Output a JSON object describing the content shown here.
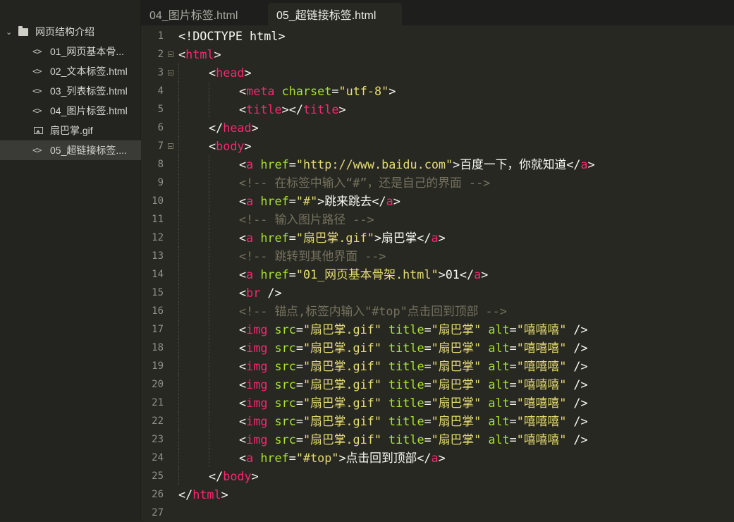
{
  "tabs": [
    {
      "label": "04_图片标签.html",
      "active": false
    },
    {
      "label": "05_超链接标签.html",
      "active": true
    }
  ],
  "sidebar": {
    "folder": "网页结构介绍",
    "files": [
      {
        "label": "01_网页基本骨...",
        "icon": "code-file-icon",
        "active": false
      },
      {
        "label": "02_文本标签.html",
        "icon": "code-file-icon",
        "active": false
      },
      {
        "label": "03_列表标签.html",
        "icon": "code-file-icon",
        "active": false
      },
      {
        "label": "04_图片标签.html",
        "icon": "code-file-icon",
        "active": false
      },
      {
        "label": "扇巴掌.gif",
        "icon": "image-file-icon",
        "active": false
      },
      {
        "label": "05_超链接标签....",
        "icon": "code-file-icon",
        "active": true
      }
    ]
  },
  "editor": {
    "colors": {
      "background": "#272822",
      "tag": "#f92672",
      "attribute": "#a6e22e",
      "string": "#e6db74",
      "comment": "#75715e",
      "text": "#f8f8f2"
    },
    "lines": [
      {
        "n": "1",
        "fold": false,
        "indent": 0,
        "tokens": [
          [
            "p",
            "<!DOCTYPE html>"
          ]
        ]
      },
      {
        "n": "2",
        "fold": true,
        "indent": 0,
        "tokens": [
          [
            "p",
            "<"
          ],
          [
            "t",
            "html"
          ],
          [
            "p",
            ">"
          ]
        ]
      },
      {
        "n": "3",
        "fold": true,
        "indent": 1,
        "tokens": [
          [
            "p",
            "<"
          ],
          [
            "t",
            "head"
          ],
          [
            "p",
            ">"
          ]
        ]
      },
      {
        "n": "4",
        "fold": false,
        "indent": 2,
        "tokens": [
          [
            "p",
            "<"
          ],
          [
            "t",
            "meta"
          ],
          [
            "p",
            " "
          ],
          [
            "a",
            "charset"
          ],
          [
            "p",
            "="
          ],
          [
            "s",
            "\"utf-8\""
          ],
          [
            "p",
            ">"
          ]
        ]
      },
      {
        "n": "5",
        "fold": false,
        "indent": 2,
        "tokens": [
          [
            "p",
            "<"
          ],
          [
            "t",
            "title"
          ],
          [
            "p",
            "></"
          ],
          [
            "t",
            "title"
          ],
          [
            "p",
            ">"
          ]
        ]
      },
      {
        "n": "6",
        "fold": false,
        "indent": 1,
        "tokens": [
          [
            "p",
            "</"
          ],
          [
            "t",
            "head"
          ],
          [
            "p",
            ">"
          ]
        ]
      },
      {
        "n": "7",
        "fold": true,
        "indent": 1,
        "tokens": [
          [
            "p",
            "<"
          ],
          [
            "t",
            "body"
          ],
          [
            "p",
            ">"
          ]
        ]
      },
      {
        "n": "8",
        "fold": false,
        "indent": 2,
        "tokens": [
          [
            "p",
            "<"
          ],
          [
            "t",
            "a"
          ],
          [
            "p",
            " "
          ],
          [
            "a",
            "href"
          ],
          [
            "p",
            "="
          ],
          [
            "s",
            "\"http://www.baidu.com\""
          ],
          [
            "p",
            ">"
          ],
          [
            "tx",
            "百度一下，你就知道"
          ],
          [
            "p",
            "</"
          ],
          [
            "t",
            "a"
          ],
          [
            "p",
            ">"
          ]
        ]
      },
      {
        "n": "9",
        "fold": false,
        "indent": 2,
        "tokens": [
          [
            "c",
            "<!-- 在标签中输入“#”，还是自己的界面 -->"
          ]
        ]
      },
      {
        "n": "10",
        "fold": false,
        "indent": 2,
        "tokens": [
          [
            "p",
            "<"
          ],
          [
            "t",
            "a"
          ],
          [
            "p",
            " "
          ],
          [
            "a",
            "href"
          ],
          [
            "p",
            "="
          ],
          [
            "s",
            "\"#\""
          ],
          [
            "p",
            ">"
          ],
          [
            "tx",
            "跳来跳去"
          ],
          [
            "p",
            "</"
          ],
          [
            "t",
            "a"
          ],
          [
            "p",
            ">"
          ]
        ]
      },
      {
        "n": "11",
        "fold": false,
        "indent": 2,
        "tokens": [
          [
            "c",
            "<!-- 输入图片路径 -->"
          ]
        ]
      },
      {
        "n": "12",
        "fold": false,
        "indent": 2,
        "tokens": [
          [
            "p",
            "<"
          ],
          [
            "t",
            "a"
          ],
          [
            "p",
            " "
          ],
          [
            "a",
            "href"
          ],
          [
            "p",
            "="
          ],
          [
            "s",
            "\"扇巴掌.gif\""
          ],
          [
            "p",
            ">"
          ],
          [
            "tx",
            "扇巴掌"
          ],
          [
            "p",
            "</"
          ],
          [
            "t",
            "a"
          ],
          [
            "p",
            ">"
          ]
        ]
      },
      {
        "n": "13",
        "fold": false,
        "indent": 2,
        "tokens": [
          [
            "c",
            "<!-- 跳转到其他界面 -->"
          ]
        ]
      },
      {
        "n": "14",
        "fold": false,
        "indent": 2,
        "tokens": [
          [
            "p",
            "<"
          ],
          [
            "t",
            "a"
          ],
          [
            "p",
            " "
          ],
          [
            "a",
            "href"
          ],
          [
            "p",
            "="
          ],
          [
            "s",
            "\"01_网页基本骨架.html\""
          ],
          [
            "p",
            ">"
          ],
          [
            "tx",
            "01"
          ],
          [
            "p",
            "</"
          ],
          [
            "t",
            "a"
          ],
          [
            "p",
            ">"
          ]
        ]
      },
      {
        "n": "15",
        "fold": false,
        "indent": 2,
        "tokens": [
          [
            "p",
            "<"
          ],
          [
            "t",
            "br"
          ],
          [
            "p",
            " />"
          ]
        ]
      },
      {
        "n": "16",
        "fold": false,
        "indent": 2,
        "tokens": [
          [
            "c",
            "<!-- 锚点,标签内输入\"#top\"点击回到顶部 -->"
          ]
        ]
      },
      {
        "n": "17",
        "fold": false,
        "indent": 2,
        "tokens": [
          [
            "p",
            "<"
          ],
          [
            "t",
            "img"
          ],
          [
            "p",
            " "
          ],
          [
            "a",
            "src"
          ],
          [
            "p",
            "="
          ],
          [
            "s",
            "\"扇巴掌.gif\""
          ],
          [
            "p",
            " "
          ],
          [
            "a",
            "title"
          ],
          [
            "p",
            "="
          ],
          [
            "s",
            "\"扇巴掌\""
          ],
          [
            "p",
            " "
          ],
          [
            "a",
            "alt"
          ],
          [
            "p",
            "="
          ],
          [
            "s",
            "\"嘻嘻嘻\""
          ],
          [
            "p",
            " />"
          ]
        ]
      },
      {
        "n": "18",
        "fold": false,
        "indent": 2,
        "tokens": [
          [
            "p",
            "<"
          ],
          [
            "t",
            "img"
          ],
          [
            "p",
            " "
          ],
          [
            "a",
            "src"
          ],
          [
            "p",
            "="
          ],
          [
            "s",
            "\"扇巴掌.gif\""
          ],
          [
            "p",
            " "
          ],
          [
            "a",
            "title"
          ],
          [
            "p",
            "="
          ],
          [
            "s",
            "\"扇巴掌\""
          ],
          [
            "p",
            " "
          ],
          [
            "a",
            "alt"
          ],
          [
            "p",
            "="
          ],
          [
            "s",
            "\"嘻嘻嘻\""
          ],
          [
            "p",
            " />"
          ]
        ]
      },
      {
        "n": "19",
        "fold": false,
        "indent": 2,
        "tokens": [
          [
            "p",
            "<"
          ],
          [
            "t",
            "img"
          ],
          [
            "p",
            " "
          ],
          [
            "a",
            "src"
          ],
          [
            "p",
            "="
          ],
          [
            "s",
            "\"扇巴掌.gif\""
          ],
          [
            "p",
            " "
          ],
          [
            "a",
            "title"
          ],
          [
            "p",
            "="
          ],
          [
            "s",
            "\"扇巴掌\""
          ],
          [
            "p",
            " "
          ],
          [
            "a",
            "alt"
          ],
          [
            "p",
            "="
          ],
          [
            "s",
            "\"嘻嘻嘻\""
          ],
          [
            "p",
            " />"
          ]
        ]
      },
      {
        "n": "20",
        "fold": false,
        "indent": 2,
        "tokens": [
          [
            "p",
            "<"
          ],
          [
            "t",
            "img"
          ],
          [
            "p",
            " "
          ],
          [
            "a",
            "src"
          ],
          [
            "p",
            "="
          ],
          [
            "s",
            "\"扇巴掌.gif\""
          ],
          [
            "p",
            " "
          ],
          [
            "a",
            "title"
          ],
          [
            "p",
            "="
          ],
          [
            "s",
            "\"扇巴掌\""
          ],
          [
            "p",
            " "
          ],
          [
            "a",
            "alt"
          ],
          [
            "p",
            "="
          ],
          [
            "s",
            "\"嘻嘻嘻\""
          ],
          [
            "p",
            " />"
          ]
        ]
      },
      {
        "n": "21",
        "fold": false,
        "indent": 2,
        "tokens": [
          [
            "p",
            "<"
          ],
          [
            "t",
            "img"
          ],
          [
            "p",
            " "
          ],
          [
            "a",
            "src"
          ],
          [
            "p",
            "="
          ],
          [
            "s",
            "\"扇巴掌.gif\""
          ],
          [
            "p",
            " "
          ],
          [
            "a",
            "title"
          ],
          [
            "p",
            "="
          ],
          [
            "s",
            "\"扇巴掌\""
          ],
          [
            "p",
            " "
          ],
          [
            "a",
            "alt"
          ],
          [
            "p",
            "="
          ],
          [
            "s",
            "\"嘻嘻嘻\""
          ],
          [
            "p",
            " />"
          ]
        ]
      },
      {
        "n": "22",
        "fold": false,
        "indent": 2,
        "tokens": [
          [
            "p",
            "<"
          ],
          [
            "t",
            "img"
          ],
          [
            "p",
            " "
          ],
          [
            "a",
            "src"
          ],
          [
            "p",
            "="
          ],
          [
            "s",
            "\"扇巴掌.gif\""
          ],
          [
            "p",
            " "
          ],
          [
            "a",
            "title"
          ],
          [
            "p",
            "="
          ],
          [
            "s",
            "\"扇巴掌\""
          ],
          [
            "p",
            " "
          ],
          [
            "a",
            "alt"
          ],
          [
            "p",
            "="
          ],
          [
            "s",
            "\"嘻嘻嘻\""
          ],
          [
            "p",
            " />"
          ]
        ]
      },
      {
        "n": "23",
        "fold": false,
        "indent": 2,
        "tokens": [
          [
            "p",
            "<"
          ],
          [
            "t",
            "img"
          ],
          [
            "p",
            " "
          ],
          [
            "a",
            "src"
          ],
          [
            "p",
            "="
          ],
          [
            "s",
            "\"扇巴掌.gif\""
          ],
          [
            "p",
            " "
          ],
          [
            "a",
            "title"
          ],
          [
            "p",
            "="
          ],
          [
            "s",
            "\"扇巴掌\""
          ],
          [
            "p",
            " "
          ],
          [
            "a",
            "alt"
          ],
          [
            "p",
            "="
          ],
          [
            "s",
            "\"嘻嘻嘻\""
          ],
          [
            "p",
            " />"
          ]
        ]
      },
      {
        "n": "24",
        "fold": false,
        "indent": 2,
        "tokens": [
          [
            "p",
            "<"
          ],
          [
            "t",
            "a"
          ],
          [
            "p",
            " "
          ],
          [
            "a",
            "href"
          ],
          [
            "p",
            "="
          ],
          [
            "s",
            "\"#top\""
          ],
          [
            "p",
            ">"
          ],
          [
            "tx",
            "点击回到顶部"
          ],
          [
            "p",
            "</"
          ],
          [
            "t",
            "a"
          ],
          [
            "p",
            ">"
          ]
        ]
      },
      {
        "n": "25",
        "fold": false,
        "indent": 1,
        "tokens": [
          [
            "p",
            "</"
          ],
          [
            "t",
            "body"
          ],
          [
            "p",
            ">"
          ]
        ]
      },
      {
        "n": "26",
        "fold": false,
        "indent": 0,
        "tokens": [
          [
            "p",
            "</"
          ],
          [
            "t",
            "html"
          ],
          [
            "p",
            ">"
          ]
        ]
      },
      {
        "n": "27",
        "fold": false,
        "indent": 0,
        "tokens": []
      }
    ]
  }
}
